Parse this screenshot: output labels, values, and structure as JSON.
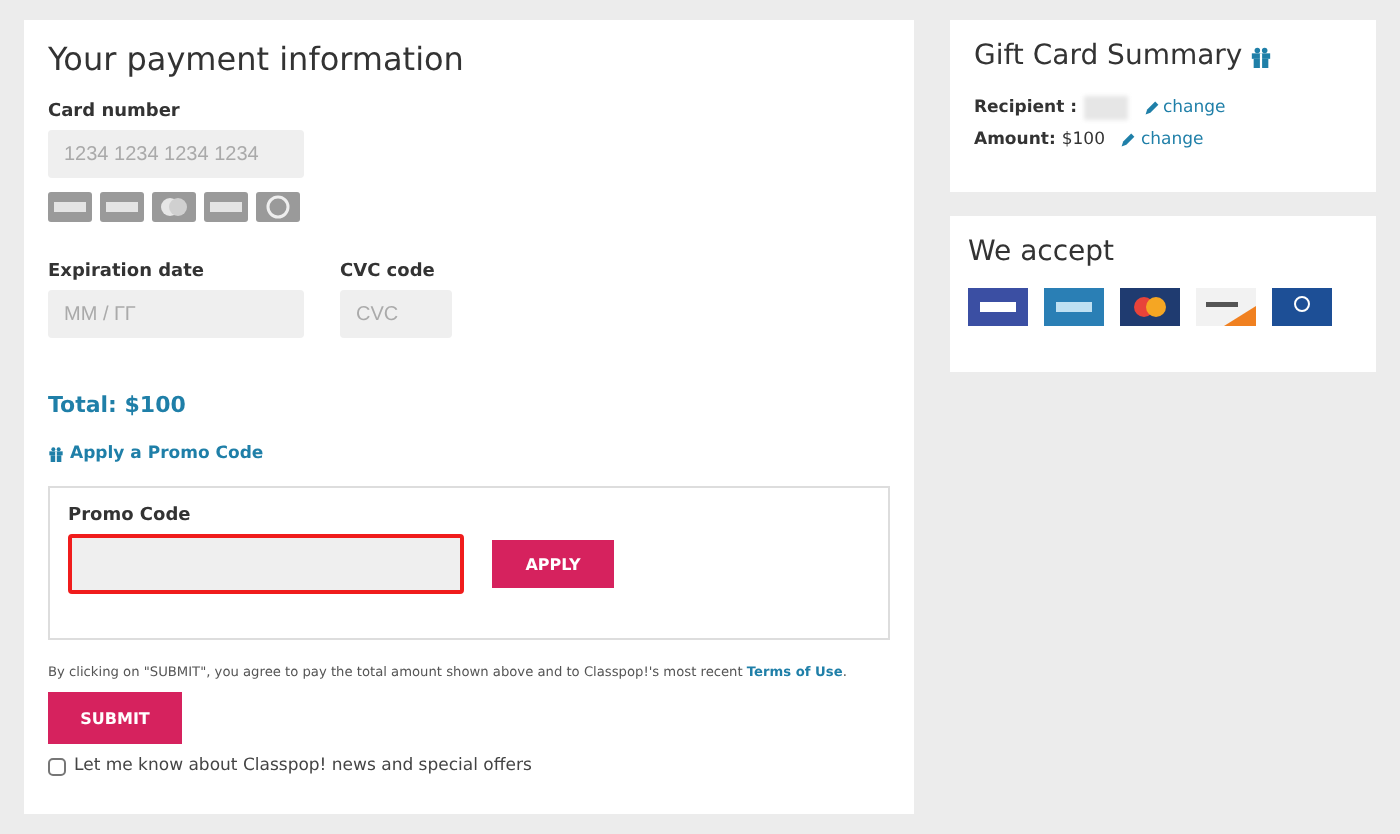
{
  "payment": {
    "title": "Your payment information",
    "card_number": {
      "label": "Card number",
      "placeholder": "1234 1234 1234 1234"
    },
    "expiration": {
      "label": "Expiration date",
      "placeholder": "MM / ГГ"
    },
    "cvc": {
      "label": "CVC code",
      "placeholder": "CVC"
    },
    "total": "Total: $100",
    "promo_link": "Apply a Promo Code",
    "promo": {
      "label": "Promo Code",
      "highlighted": true,
      "button": "APPLY"
    },
    "terms": "By clicking on \"SUBMIT\", you agree to pay the total amount shown above and to Classpop!'s most recent ",
    "terms_link": "Terms of Use",
    "terms_end": ".",
    "submit": "SUBMIT",
    "newsletter": {
      "label": "Let me know about Classpop! news and special offers",
      "checked": false
    }
  },
  "summary": {
    "title": "Gift Card Summary",
    "rows": [
      {
        "label": "Recipient :",
        "redacted": true,
        "link": "change"
      },
      {
        "label": "Amount:",
        "redacted": false,
        "value": "$100",
        "link": "change"
      }
    ]
  },
  "accept": {
    "title": "We accept"
  }
}
